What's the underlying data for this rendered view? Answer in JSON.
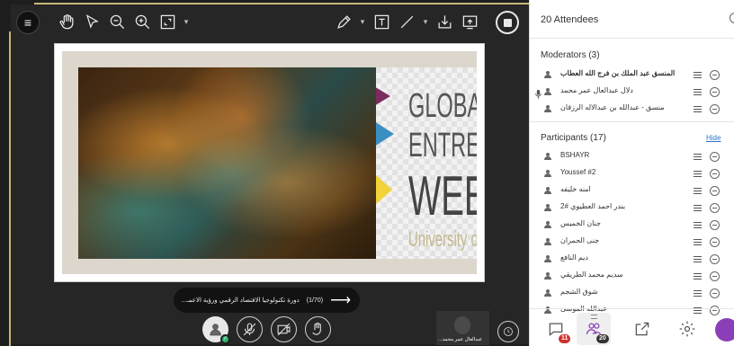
{
  "toolbar": {
    "left_icons": [
      "hand-icon",
      "pointer-icon",
      "zoom-out-icon",
      "zoom-in-icon",
      "fit-screen-icon",
      "chevron-down-icon"
    ],
    "right_icons": [
      "pen-icon",
      "chevron-down-icon",
      "text-icon",
      "line-icon",
      "chevron-down-icon",
      "download-icon",
      "share-screen-icon"
    ]
  },
  "slide": {
    "title_lines": [
      "GLOBAL",
      "ENTREPREN",
      "WEEK",
      "University of P"
    ],
    "title_color": "#555555",
    "accent_colors": [
      "#7b2b5e",
      "#e6b622",
      "#3a8fc0",
      "#f2d33a"
    ]
  },
  "slide_nav": {
    "counter": "(1/70)",
    "title": "دورة تكنولوجيا الاقتصاد الرقمي ورؤية الاعمـ..."
  },
  "video": {
    "name": "عبدالعال عمر محمد..."
  },
  "panel": {
    "title": "20 Attendees",
    "moderators_heading": "Moderators (3)",
    "participants_heading": "Participants (17)",
    "hide_label": "Hide",
    "moderators": [
      {
        "name": "المنسق عبد الملك بن فرج الله العطاب",
        "mic": false,
        "bold": true
      },
      {
        "name": "دلال عبدالعال عمر محمد",
        "mic": true,
        "bold": false
      },
      {
        "name": "منسق - عبدالله بن عبدالاله الرزقان",
        "mic": false,
        "bold": false
      }
    ],
    "participants": [
      {
        "name": "BSHAYR",
        "rtl": false
      },
      {
        "name": "Youssef #2",
        "rtl": false
      },
      {
        "name": "امنه خليفه",
        "rtl": true
      },
      {
        "name": "بندر احمد العطيوي #2",
        "rtl": true
      },
      {
        "name": "جنان الخميس",
        "rtl": true
      },
      {
        "name": "جنى الحمران",
        "rtl": true
      },
      {
        "name": "ديم النافع",
        "rtl": true
      },
      {
        "name": "سديم محمد الطريقي",
        "rtl": true
      },
      {
        "name": "شوق الشجم",
        "rtl": true
      },
      {
        "name": "عبدالله الموسى",
        "rtl": true
      }
    ],
    "footer": {
      "chat_badge": "11",
      "attendees_badge": "20"
    },
    "accent_color": "#8a3fb8"
  }
}
